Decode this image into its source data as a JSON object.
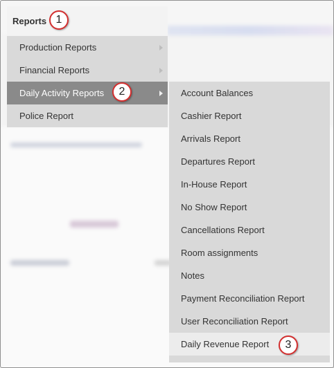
{
  "menu": {
    "title": "Reports",
    "items": [
      {
        "label": "Production Reports"
      },
      {
        "label": "Financial Reports"
      },
      {
        "label": "Daily Activity Reports"
      },
      {
        "label": "Police Report"
      }
    ]
  },
  "submenu": {
    "items": [
      {
        "label": "Account Balances"
      },
      {
        "label": "Cashier Report"
      },
      {
        "label": "Arrivals Report"
      },
      {
        "label": "Departures Report"
      },
      {
        "label": "In-House Report"
      },
      {
        "label": "No Show Report"
      },
      {
        "label": "Cancellations Report"
      },
      {
        "label": "Room assignments"
      },
      {
        "label": "Notes"
      },
      {
        "label": "Payment Reconciliation Report"
      },
      {
        "label": "User Reconciliation Report"
      },
      {
        "label": "Daily Revenue Report"
      }
    ]
  },
  "callouts": [
    "1",
    "2",
    "3"
  ],
  "colors": {
    "menu_bg": "#d9d9d9",
    "active_bg": "#8a8a8a",
    "highlight_bg": "#ececec",
    "callout_border": "#d32f2f"
  }
}
